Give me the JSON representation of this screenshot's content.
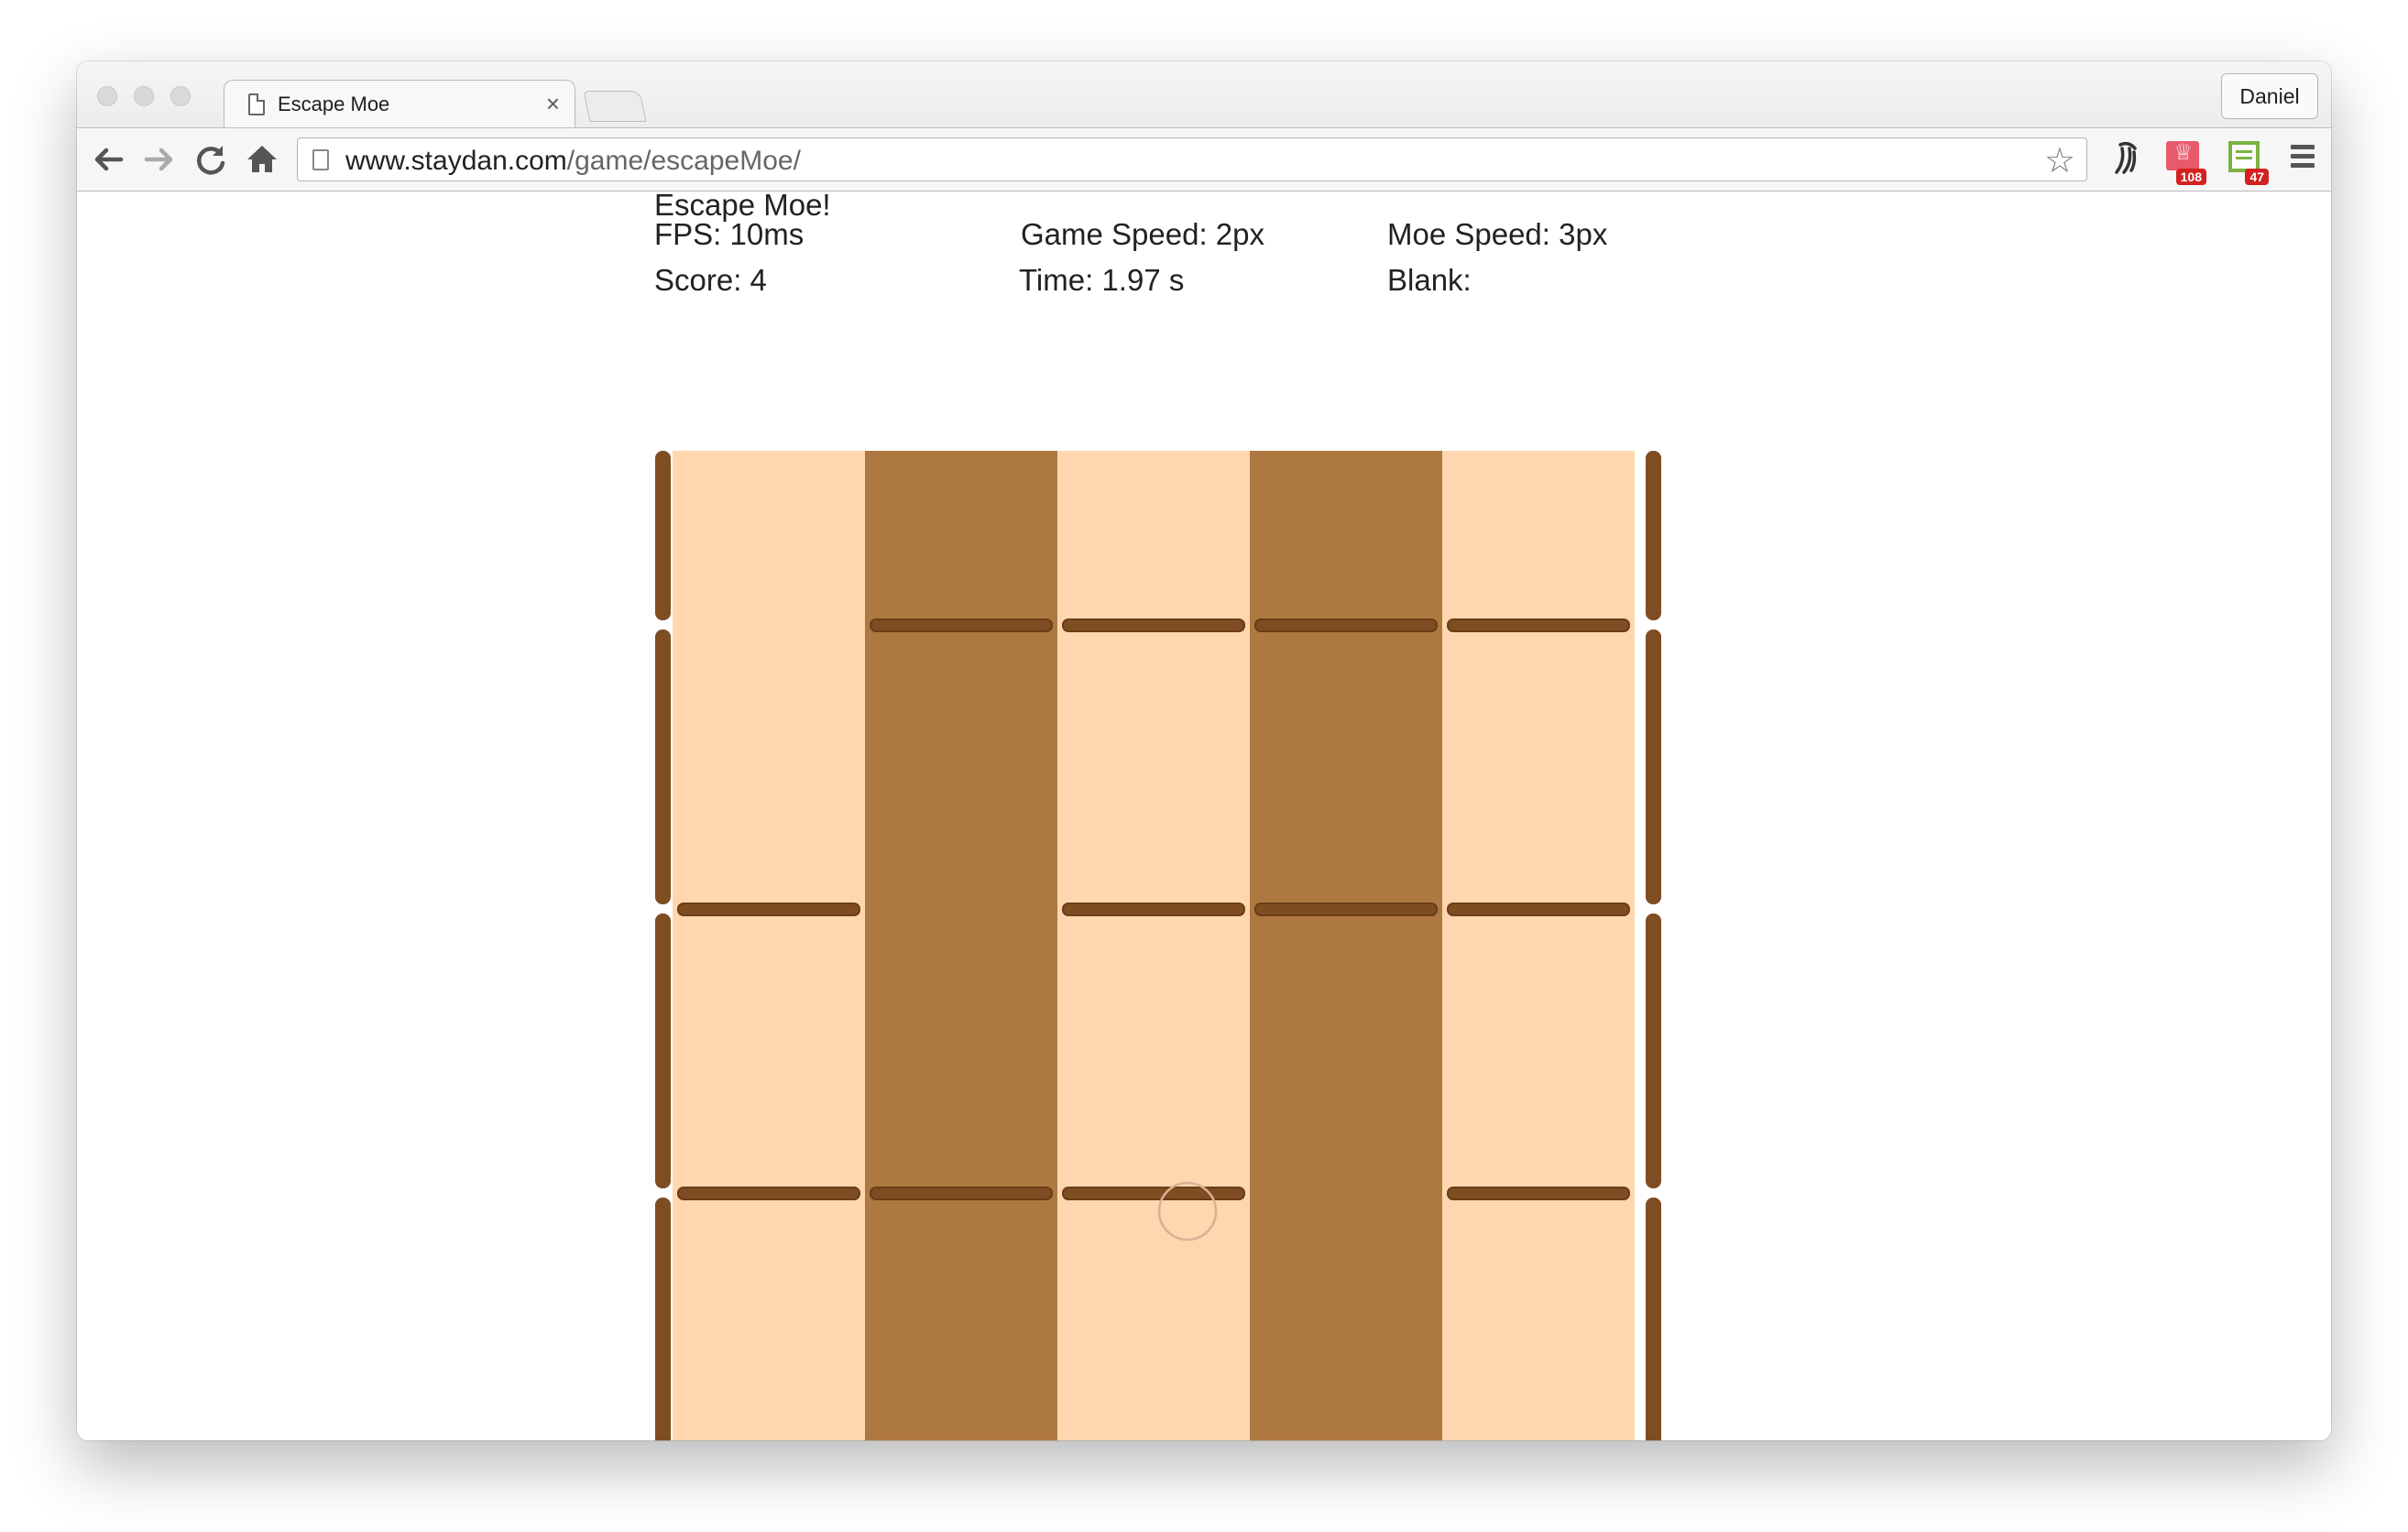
{
  "browser": {
    "tab_title": "Escape Moe",
    "tab_close": "×",
    "profile_name": "Daniel",
    "url_host": "www.staydan.com",
    "url_path": "/game/escapeMoe/",
    "extensions": [
      {
        "name": "trophy-extension-icon",
        "badge": "108"
      },
      {
        "name": "list-extension-icon",
        "badge": "47"
      }
    ]
  },
  "game": {
    "title": "Escape Moe!",
    "fps": "FPS: 10ms",
    "game_speed": "Game Speed: 2px",
    "moe_speed": "Moe Speed: 3px",
    "score": "Score: 4",
    "time": "Time: 1.97 s",
    "blank": "Blank:"
  },
  "board": {
    "colors": {
      "light": "#fed7af",
      "dark": "#ad7941",
      "wall": "#7f4d22",
      "player_outline": "#d7b394"
    },
    "columns": [
      "light",
      "dark",
      "light",
      "dark",
      "light"
    ],
    "wall_rows": [
      [
        false,
        true,
        true,
        true,
        true
      ],
      [
        true,
        false,
        true,
        true,
        true
      ],
      [
        true,
        true,
        true,
        false,
        true
      ],
      [
        true,
        true,
        false,
        true,
        true
      ]
    ]
  }
}
